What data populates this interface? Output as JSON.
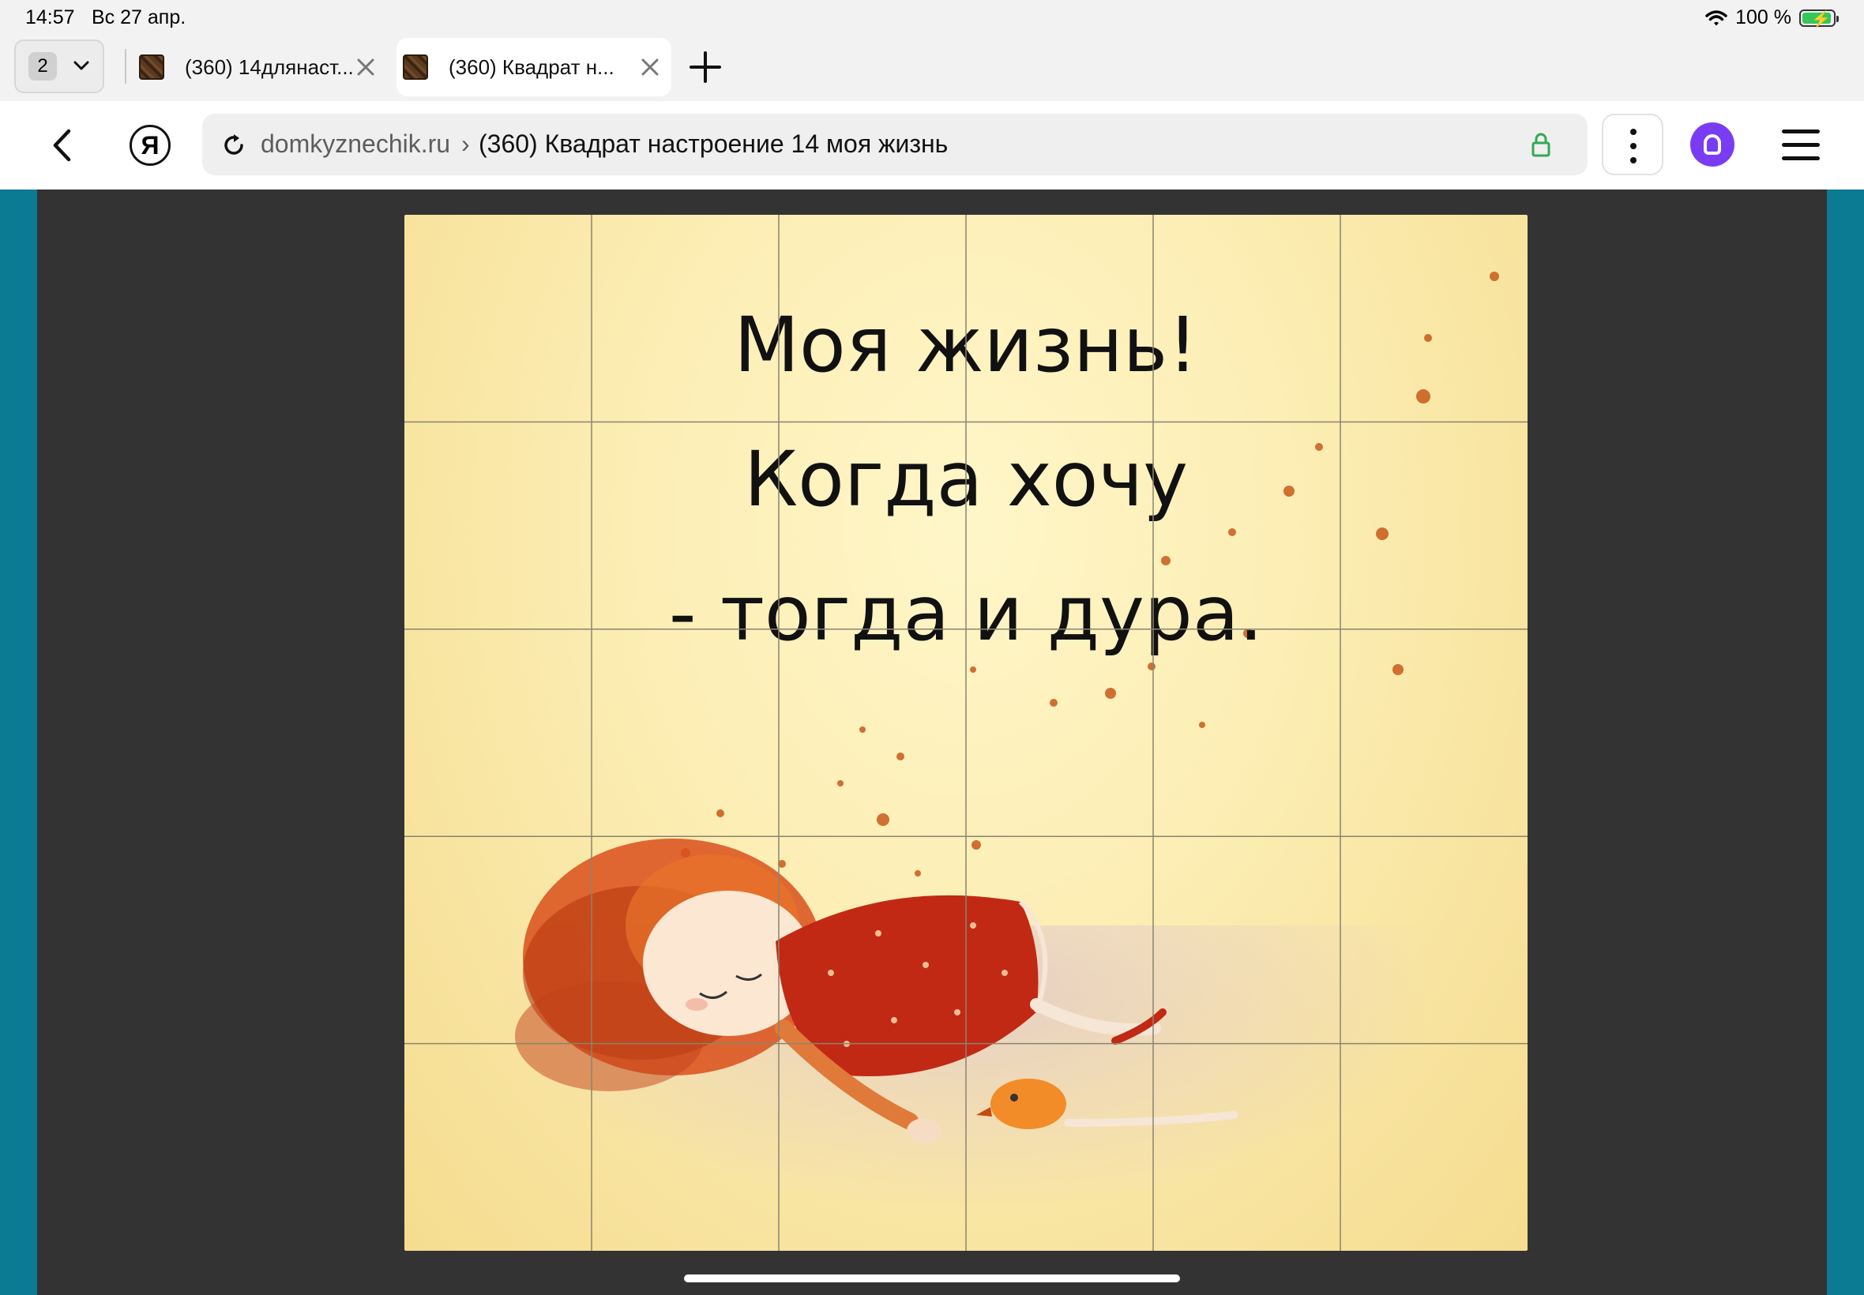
{
  "status": {
    "time": "14:57",
    "date": "Вс 27 апр.",
    "battery": "100 %"
  },
  "tabs": {
    "count": "2",
    "items": [
      {
        "title": "(360) 14длянаст..."
      },
      {
        "title": "(360) Квадрат н..."
      }
    ],
    "active_index": 1
  },
  "toolbar": {
    "url_domain": "domkyznechik.ru",
    "url_separator": "›",
    "url_title": "(360) Квадрат настроение 14 моя жизнь",
    "yandex_logo": "Я"
  },
  "puzzle": {
    "caption_lines": [
      "Моя жизнь!",
      "Когда хочу",
      "- тогда и дура."
    ],
    "columns": 6,
    "rows": 5
  },
  "colors": {
    "side_border": "#0a7b92",
    "stage_background": "#333333",
    "alice_purple": "#7a3cf2",
    "lock_green": "#34a853"
  }
}
